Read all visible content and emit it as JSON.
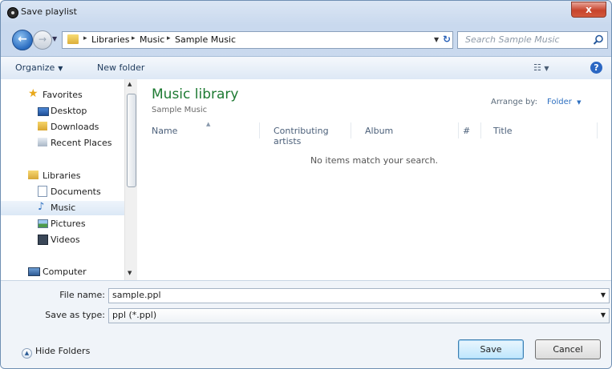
{
  "window": {
    "title": "Save playlist",
    "close_label": "x"
  },
  "address": {
    "crumbs": [
      "Libraries",
      "Music",
      "Sample Music"
    ],
    "separator": "▸"
  },
  "search": {
    "placeholder": "Search Sample Music"
  },
  "toolbar": {
    "organize_label": "Organize",
    "new_folder_label": "New folder",
    "help_label": "?"
  },
  "navpane": {
    "favorites": {
      "label": "Favorites",
      "items": [
        "Desktop",
        "Downloads",
        "Recent Places"
      ]
    },
    "libraries": {
      "label": "Libraries",
      "items": [
        "Documents",
        "Music",
        "Pictures",
        "Videos"
      ],
      "selected": "Music"
    },
    "computer": {
      "label": "Computer"
    }
  },
  "content": {
    "library_title": "Music library",
    "library_subtitle": "Sample Music",
    "arrange_label": "Arrange by:",
    "arrange_value": "Folder",
    "columns": [
      "Name",
      "Contributing artists",
      "Album",
      "#",
      "Title"
    ],
    "empty_message": "No items match your search."
  },
  "form": {
    "file_name_label": "File name:",
    "file_name_value": "sample.ppl",
    "save_type_label": "Save as type:",
    "save_type_value": "ppl (*.ppl)"
  },
  "footer": {
    "hide_folders_label": "Hide Folders",
    "save_label": "Save",
    "cancel_label": "Cancel"
  },
  "colors": {
    "accent": "#1d7a32",
    "link": "#2d6fc0",
    "selection": "#dbe8f6"
  }
}
